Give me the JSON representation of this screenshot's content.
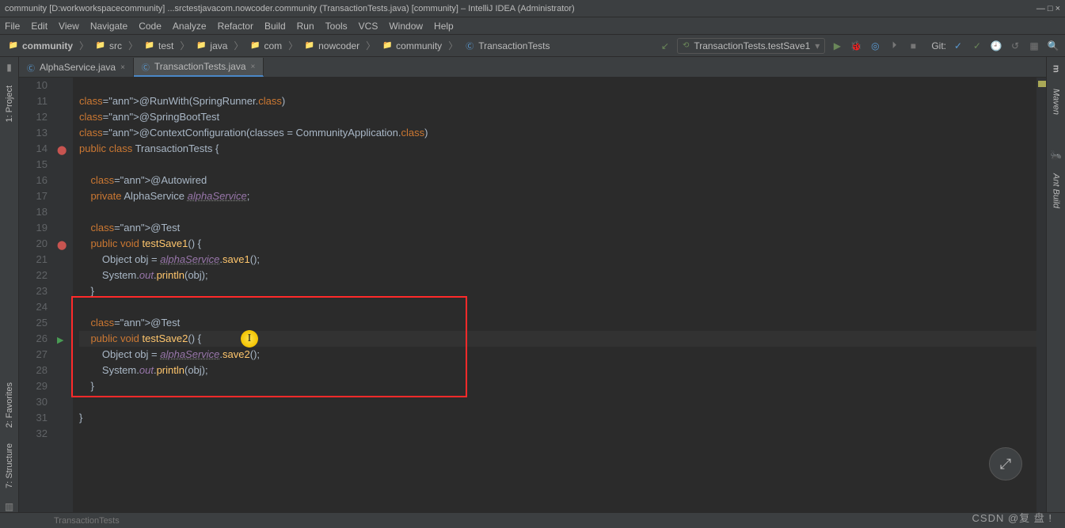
{
  "title": "community [D:workworkspacecommunity] ...srctestjavacom.nowcoder.community (TransactionTests.java) [community] – IntelliJ IDEA (Administrator)",
  "menu": [
    "File",
    "Edit",
    "View",
    "Navigate",
    "Code",
    "Analyze",
    "Refactor",
    "Build",
    "Run",
    "Tools",
    "VCS",
    "Window",
    "Help"
  ],
  "breadcrumbs": [
    {
      "icon": "folder",
      "label": "community"
    },
    {
      "icon": "folder",
      "label": "src"
    },
    {
      "icon": "folder",
      "label": "test"
    },
    {
      "icon": "folder",
      "label": "java"
    },
    {
      "icon": "folder",
      "label": "com"
    },
    {
      "icon": "folder",
      "label": "nowcoder"
    },
    {
      "icon": "folder",
      "label": "community"
    },
    {
      "icon": "class",
      "label": "TransactionTests"
    }
  ],
  "run_config": "TransactionTests.testSave1",
  "git_label": "Git:",
  "tabs": [
    {
      "label": "AlphaService.java",
      "active": false
    },
    {
      "label": "TransactionTests.java",
      "active": true
    }
  ],
  "left_tools": [
    {
      "label": "1: Project"
    },
    {
      "label": "2: Favorites"
    },
    {
      "label": "7: Structure"
    }
  ],
  "right_tools": [
    {
      "label": "m",
      "sub": "Maven"
    },
    {
      "label": "Ant Build"
    }
  ],
  "lines": {
    "start": 10,
    "end": 32,
    "content": [
      "",
      "@RunWith(SpringRunner.class)",
      "@SpringBootTest",
      "@ContextConfiguration(classes = CommunityApplication.class)",
      "public class TransactionTests {",
      "",
      "    @Autowired",
      "    private AlphaService alphaService;",
      "",
      "    @Test",
      "    public void testSave1() {",
      "        Object obj = alphaService.save1();",
      "        System.out.println(obj);",
      "    }",
      "",
      "    @Test",
      "    public void testSave2() {",
      "        Object obj = alphaService.save2();",
      "        System.out.println(obj);",
      "    }",
      "",
      "}",
      ""
    ]
  },
  "status_left": "TransactionTests",
  "watermark": "CSDN @复 盘 !",
  "highlight_box": {
    "top_line": 24,
    "bottom_line": 29
  },
  "cursor_line": 26
}
